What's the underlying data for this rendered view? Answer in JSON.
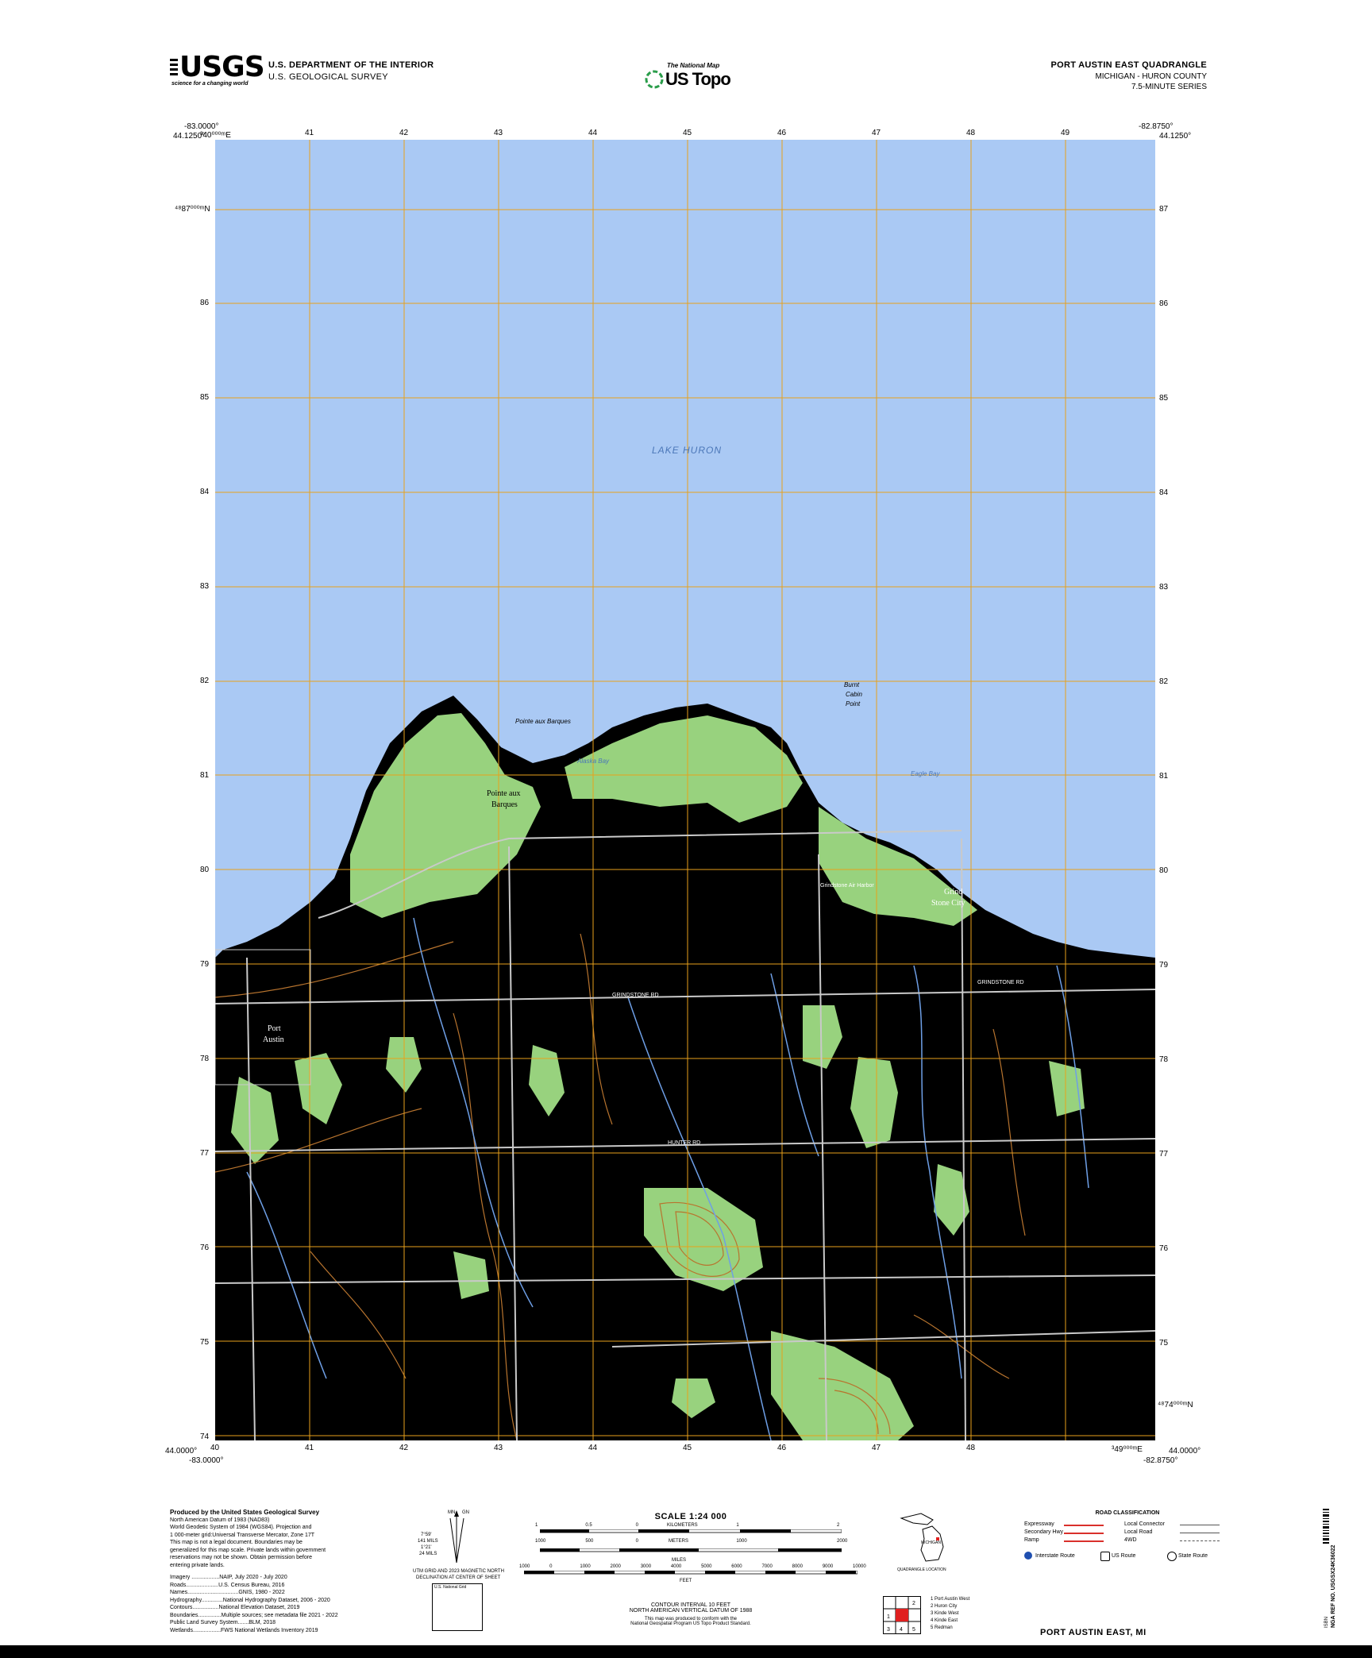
{
  "header": {
    "agency_line1": "U.S. DEPARTMENT OF THE INTERIOR",
    "agency_line2": "U.S. GEOLOGICAL SURVEY",
    "usgs_logo_text": "USGS",
    "usgs_tagline": "science for a changing world",
    "tnm_top": "The National Map",
    "tnm_bottom": "US Topo",
    "quad_title": "PORT AUSTIN EAST QUADRANGLE",
    "quad_state": "MICHIGAN - HURON COUNTY",
    "quad_series": "7.5-MINUTE SERIES"
  },
  "corners": {
    "nw_lon": "-83.0000°",
    "nw_lat": "44.1250°",
    "ne_lon": "-82.8750°",
    "ne_lat": "44.1250°",
    "sw_lat": "44.0000°",
    "sw_lon": "-83.0000°",
    "se_lat": "44.0000°",
    "se_lon": "-82.8750°"
  },
  "grid": {
    "top_first": "³40⁰⁰⁰ᵐE",
    "top_ticks": [
      "41",
      "42",
      "43",
      "44",
      "45",
      "46",
      "47",
      "48",
      "49"
    ],
    "bottom_ticks": [
      "40",
      "41",
      "42",
      "43",
      "44",
      "45",
      "46",
      "47",
      "48"
    ],
    "bottom_last": "³49⁰⁰⁰ᵐE",
    "left_first": "⁴⁸87⁰⁰⁰ᵐN",
    "left_ticks": [
      "86",
      "85",
      "84",
      "83",
      "82",
      "81",
      "80",
      "79",
      "78",
      "77",
      "76",
      "75",
      "74"
    ],
    "right_ticks": [
      "87",
      "86",
      "85",
      "84",
      "83",
      "82",
      "81",
      "80",
      "79",
      "78",
      "77",
      "76",
      "75"
    ],
    "right_last": "⁴⁸74⁰⁰⁰ᵐN"
  },
  "map_labels": {
    "lake": "LAKE HURON",
    "pointe_aux_barques_point": "Pointe aux Barques",
    "pointe_aux_barques_town_1": "Pointe aux",
    "pointe_aux_barques_town_2": "Barques",
    "burnt_cabin_1": "Burnt",
    "burnt_cabin_2": "Cabin",
    "burnt_cabin_3": "Point",
    "alaska_bay": "Alaska Bay",
    "eagle_bay": "Eagle Bay",
    "grind_stone_1": "Grind",
    "grind_stone_2": "Stone City",
    "port_austin_1": "Port",
    "port_austin_2": "Austin",
    "grindstone_rd": "GRINDSTONE RD",
    "grindstone_rd_2": "GRINDSTONE RD",
    "hunter_rd": "HUNTER RD",
    "airport": "Grindstone Air Harbor"
  },
  "colors": {
    "water": "#aac9f4",
    "land": "#000000",
    "vegetation": "#98d27e",
    "grid": "#e8a11b",
    "contour": "#b8742e",
    "road": "#c9c9c9",
    "stream": "#6e9fe6"
  },
  "footer": {
    "produced_by": "Produced by the United States Geological Survey",
    "datum_1": "North American Datum of 1983 (NAD83)",
    "datum_2": "World Geodetic System of 1984 (WGS84). Projection and",
    "datum_3": "1 000-meter grid:Universal Transverse Mercator, Zone 17T",
    "note_1": "This map is not a legal document. Boundaries may be",
    "note_2": "generalized for this map scale. Private lands within government",
    "note_3": "reservations may not be shown. Obtain permission before",
    "note_4": "entering private lands.",
    "src_imagery": "Imagery ..................NAIP, July 2020 - July 2020",
    "src_roads": "Roads.....................U.S. Census Bureau, 2016",
    "src_names": "Names.................................GNIS, 1980 - 2022",
    "src_hydro": "Hydrography..............National Hydrography Dataset, 2006 - 2020",
    "src_contours": "Contours.................National Elevation Dataset, 2019",
    "src_boundaries": "Boundaries...............Multiple sources; see metadata file 2021 - 2022",
    "src_plss": "Public Land Survey System.......BLM, 2018",
    "src_wetlands": "Wetlands..................FWS National Wetlands Inventory 2019",
    "decl_1": "UTM GRID AND 2023 MAGNETIC NORTH",
    "decl_2": "DECLINATION AT CENTER OF SHEET",
    "decl_gn": "GN",
    "decl_mn": "MN",
    "decl_a": "7°59'",
    "decl_b": "141 MILS",
    "decl_c": "1°21'",
    "decl_d": "24 MILS",
    "nat_grid": "U.S. National Grid",
    "scale_title": "SCALE 1:24 000",
    "unit_km": "KILOMETERS",
    "unit_m": "METERS",
    "unit_mi": "MILES",
    "unit_ft": "FEET",
    "km_ticks": [
      "1",
      "0.5",
      "0",
      "",
      "1",
      "",
      "2"
    ],
    "m_ticks": [
      "1000",
      "500",
      "0",
      "",
      "1000",
      "",
      "2000"
    ],
    "mi_ticks": [
      "1",
      "0.5",
      "0",
      "",
      "1"
    ],
    "ft_ticks": [
      "1000",
      "0",
      "1000",
      "2000",
      "3000",
      "4000",
      "5000",
      "6000",
      "7000",
      "8000",
      "9000",
      "10000"
    ],
    "contour_1": "CONTOUR INTERVAL 10 FEET",
    "contour_2": "NORTH AMERICAN VERTICAL DATUM OF 1988",
    "std_1": "This map was produced to conform with the",
    "std_2": "National Geospatial Program US Topo Product Standard.",
    "state_label": "MICHIGAN",
    "quad_location": "QUADRANGLE LOCATION",
    "adjoining": [
      "1 Port Austin West",
      "2 Huron City",
      "3 Kinde West",
      "4 Kinde East",
      "5 Redman"
    ],
    "road_class_title": "ROAD CLASSIFICATION",
    "road_left": [
      "Expressway",
      "Secondary Hwy",
      "Ramp"
    ],
    "road_right": [
      "Local Connector",
      "Local Road",
      "4WD"
    ],
    "shield_1": "Interstate Route",
    "shield_2": "US Route",
    "shield_3": "State Route",
    "bottom_name": "PORT AUSTIN EAST,  MI",
    "barcode_1": "NGA REF NO. USGSX24K36022",
    "barcode_2": "ISBN"
  }
}
